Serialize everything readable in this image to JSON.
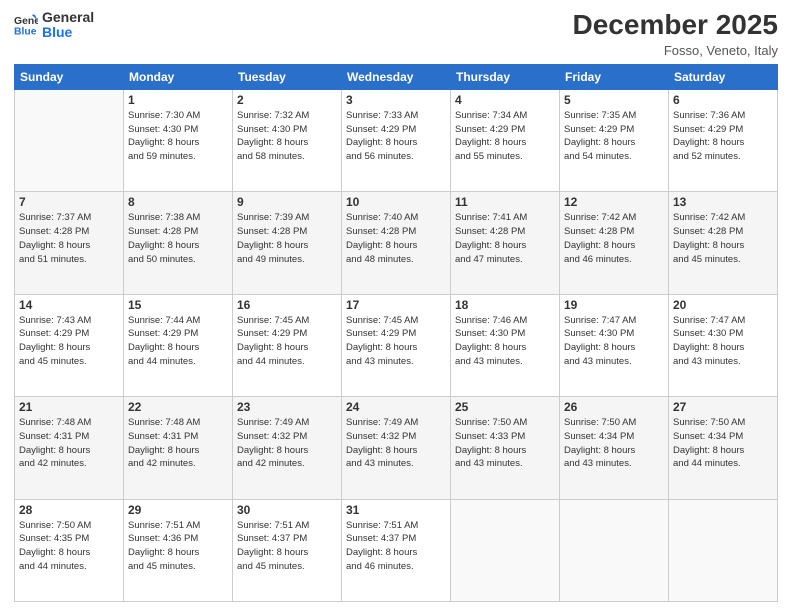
{
  "logo": {
    "line1": "General",
    "line2": "Blue"
  },
  "title": "December 2025",
  "subtitle": "Fosso, Veneto, Italy",
  "days_header": [
    "Sunday",
    "Monday",
    "Tuesday",
    "Wednesday",
    "Thursday",
    "Friday",
    "Saturday"
  ],
  "weeks": [
    [
      {
        "num": "",
        "info": ""
      },
      {
        "num": "1",
        "info": "Sunrise: 7:30 AM\nSunset: 4:30 PM\nDaylight: 8 hours\nand 59 minutes."
      },
      {
        "num": "2",
        "info": "Sunrise: 7:32 AM\nSunset: 4:30 PM\nDaylight: 8 hours\nand 58 minutes."
      },
      {
        "num": "3",
        "info": "Sunrise: 7:33 AM\nSunset: 4:29 PM\nDaylight: 8 hours\nand 56 minutes."
      },
      {
        "num": "4",
        "info": "Sunrise: 7:34 AM\nSunset: 4:29 PM\nDaylight: 8 hours\nand 55 minutes."
      },
      {
        "num": "5",
        "info": "Sunrise: 7:35 AM\nSunset: 4:29 PM\nDaylight: 8 hours\nand 54 minutes."
      },
      {
        "num": "6",
        "info": "Sunrise: 7:36 AM\nSunset: 4:29 PM\nDaylight: 8 hours\nand 52 minutes."
      }
    ],
    [
      {
        "num": "7",
        "info": "Sunrise: 7:37 AM\nSunset: 4:28 PM\nDaylight: 8 hours\nand 51 minutes."
      },
      {
        "num": "8",
        "info": "Sunrise: 7:38 AM\nSunset: 4:28 PM\nDaylight: 8 hours\nand 50 minutes."
      },
      {
        "num": "9",
        "info": "Sunrise: 7:39 AM\nSunset: 4:28 PM\nDaylight: 8 hours\nand 49 minutes."
      },
      {
        "num": "10",
        "info": "Sunrise: 7:40 AM\nSunset: 4:28 PM\nDaylight: 8 hours\nand 48 minutes."
      },
      {
        "num": "11",
        "info": "Sunrise: 7:41 AM\nSunset: 4:28 PM\nDaylight: 8 hours\nand 47 minutes."
      },
      {
        "num": "12",
        "info": "Sunrise: 7:42 AM\nSunset: 4:28 PM\nDaylight: 8 hours\nand 46 minutes."
      },
      {
        "num": "13",
        "info": "Sunrise: 7:42 AM\nSunset: 4:28 PM\nDaylight: 8 hours\nand 45 minutes."
      }
    ],
    [
      {
        "num": "14",
        "info": "Sunrise: 7:43 AM\nSunset: 4:29 PM\nDaylight: 8 hours\nand 45 minutes."
      },
      {
        "num": "15",
        "info": "Sunrise: 7:44 AM\nSunset: 4:29 PM\nDaylight: 8 hours\nand 44 minutes."
      },
      {
        "num": "16",
        "info": "Sunrise: 7:45 AM\nSunset: 4:29 PM\nDaylight: 8 hours\nand 44 minutes."
      },
      {
        "num": "17",
        "info": "Sunrise: 7:45 AM\nSunset: 4:29 PM\nDaylight: 8 hours\nand 43 minutes."
      },
      {
        "num": "18",
        "info": "Sunrise: 7:46 AM\nSunset: 4:30 PM\nDaylight: 8 hours\nand 43 minutes."
      },
      {
        "num": "19",
        "info": "Sunrise: 7:47 AM\nSunset: 4:30 PM\nDaylight: 8 hours\nand 43 minutes."
      },
      {
        "num": "20",
        "info": "Sunrise: 7:47 AM\nSunset: 4:30 PM\nDaylight: 8 hours\nand 43 minutes."
      }
    ],
    [
      {
        "num": "21",
        "info": "Sunrise: 7:48 AM\nSunset: 4:31 PM\nDaylight: 8 hours\nand 42 minutes."
      },
      {
        "num": "22",
        "info": "Sunrise: 7:48 AM\nSunset: 4:31 PM\nDaylight: 8 hours\nand 42 minutes."
      },
      {
        "num": "23",
        "info": "Sunrise: 7:49 AM\nSunset: 4:32 PM\nDaylight: 8 hours\nand 42 minutes."
      },
      {
        "num": "24",
        "info": "Sunrise: 7:49 AM\nSunset: 4:32 PM\nDaylight: 8 hours\nand 43 minutes."
      },
      {
        "num": "25",
        "info": "Sunrise: 7:50 AM\nSunset: 4:33 PM\nDaylight: 8 hours\nand 43 minutes."
      },
      {
        "num": "26",
        "info": "Sunrise: 7:50 AM\nSunset: 4:34 PM\nDaylight: 8 hours\nand 43 minutes."
      },
      {
        "num": "27",
        "info": "Sunrise: 7:50 AM\nSunset: 4:34 PM\nDaylight: 8 hours\nand 44 minutes."
      }
    ],
    [
      {
        "num": "28",
        "info": "Sunrise: 7:50 AM\nSunset: 4:35 PM\nDaylight: 8 hours\nand 44 minutes."
      },
      {
        "num": "29",
        "info": "Sunrise: 7:51 AM\nSunset: 4:36 PM\nDaylight: 8 hours\nand 45 minutes."
      },
      {
        "num": "30",
        "info": "Sunrise: 7:51 AM\nSunset: 4:37 PM\nDaylight: 8 hours\nand 45 minutes."
      },
      {
        "num": "31",
        "info": "Sunrise: 7:51 AM\nSunset: 4:37 PM\nDaylight: 8 hours\nand 46 minutes."
      },
      {
        "num": "",
        "info": ""
      },
      {
        "num": "",
        "info": ""
      },
      {
        "num": "",
        "info": ""
      }
    ]
  ]
}
